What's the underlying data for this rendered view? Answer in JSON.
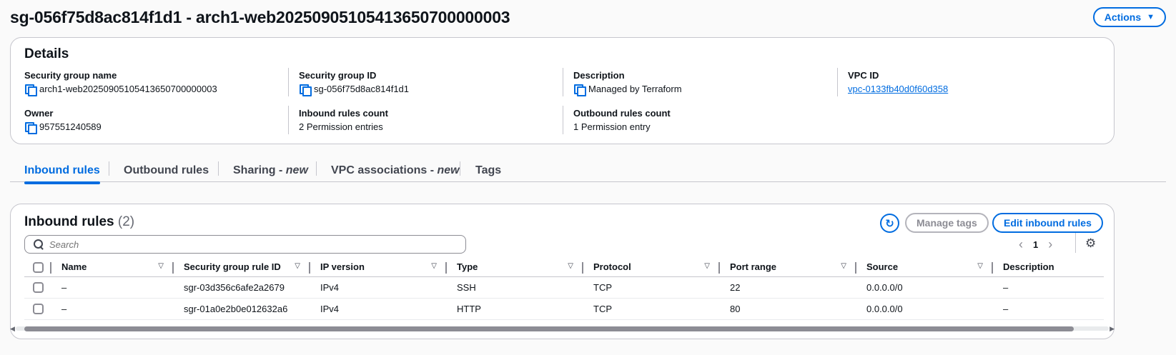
{
  "header": {
    "title": "sg-056f75d8ac814f1d1 - arch1-web20250905105413650700000003",
    "actions_label": "Actions"
  },
  "details": {
    "heading": "Details",
    "sg_name_label": "Security group name",
    "sg_name": "arch1-web20250905105413650700000003",
    "sg_id_label": "Security group ID",
    "sg_id": "sg-056f75d8ac814f1d1",
    "description_label": "Description",
    "description": "Managed by Terraform",
    "vpc_id_label": "VPC ID",
    "vpc_id": "vpc-0133fb40d0f60d358",
    "owner_label": "Owner",
    "owner": "957551240589",
    "inbound_count_label": "Inbound rules count",
    "inbound_count": "2 Permission entries",
    "outbound_count_label": "Outbound rules count",
    "outbound_count": "1 Permission entry"
  },
  "tabs": [
    {
      "label": "Inbound rules",
      "suffix": ""
    },
    {
      "label": "Outbound rules",
      "suffix": ""
    },
    {
      "label": "Sharing - ",
      "suffix": "new"
    },
    {
      "label": "VPC associations - ",
      "suffix": "new"
    },
    {
      "label": "Tags",
      "suffix": ""
    }
  ],
  "rules": {
    "title": "Inbound rules",
    "count": "(2)",
    "manage_tags": "Manage tags",
    "edit_rules": "Edit inbound rules",
    "search_placeholder": "Search",
    "page": "1",
    "columns": [
      "Name",
      "Security group rule ID",
      "IP version",
      "Type",
      "Protocol",
      "Port range",
      "Source",
      "Description"
    ],
    "rows": [
      [
        "–",
        "sgr-03d356c6afe2a2679",
        "IPv4",
        "SSH",
        "TCP",
        "22",
        "0.0.0.0/0",
        "–"
      ],
      [
        "–",
        "sgr-01a0e2b0e012632a6",
        "IPv4",
        "HTTP",
        "TCP",
        "80",
        "0.0.0.0/0",
        "–"
      ]
    ]
  },
  "colors": {
    "accent": "#006ce0",
    "border": "#c6c6cd"
  }
}
